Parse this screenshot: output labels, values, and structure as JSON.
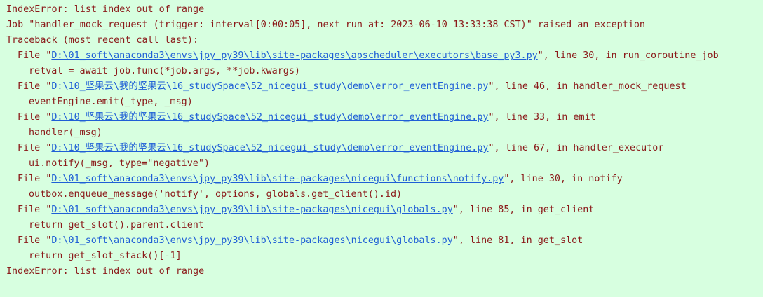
{
  "console": {
    "colors": {
      "background": "#d7ffe0",
      "error_text": "#8b1a1a",
      "link": "#1f5fd6"
    },
    "lines": [
      {
        "text": "IndexError: list index out of range"
      },
      {
        "text": "Job \"handler_mock_request (trigger: interval[0:00:05], next run at: 2023-06-10 13:33:38 CST)\" raised an exception"
      },
      {
        "text": "Traceback (most recent call last):"
      },
      {
        "file_prefix": "File \"",
        "path": "D:\\01_soft\\anaconda3\\envs\\jpy_py39\\lib\\site-packages\\apscheduler\\executors\\base_py3.py",
        "rest": "\", line 30, in run_coroutine_job"
      },
      {
        "code": "retval = await job.func(*job.args, **job.kwargs)"
      },
      {
        "file_prefix": "File \"",
        "path": "D:\\10_坚果云\\我的坚果云\\16_studySpace\\52_nicegui_study\\demo\\error_eventEngine.py",
        "rest": "\", line 46, in handler_mock_request"
      },
      {
        "code": "eventEngine.emit(_type, _msg)"
      },
      {
        "file_prefix": "File \"",
        "path": "D:\\10_坚果云\\我的坚果云\\16_studySpace\\52_nicegui_study\\demo\\error_eventEngine.py",
        "rest": "\", line 33, in emit"
      },
      {
        "code": "handler(_msg)"
      },
      {
        "file_prefix": "File \"",
        "path": "D:\\10_坚果云\\我的坚果云\\16_studySpace\\52_nicegui_study\\demo\\error_eventEngine.py",
        "rest": "\", line 67, in handler_executor"
      },
      {
        "code": "ui.notify(_msg, type=\"negative\")"
      },
      {
        "file_prefix": "File \"",
        "path": "D:\\01_soft\\anaconda3\\envs\\jpy_py39\\lib\\site-packages\\nicegui\\functions\\notify.py",
        "rest": "\", line 30, in notify"
      },
      {
        "code": "outbox.enqueue_message('notify', options, globals.get_client().id)"
      },
      {
        "file_prefix": "File \"",
        "path": "D:\\01_soft\\anaconda3\\envs\\jpy_py39\\lib\\site-packages\\nicegui\\globals.py",
        "rest": "\", line 85, in get_client"
      },
      {
        "code": "return get_slot().parent.client"
      },
      {
        "file_prefix": "File \"",
        "path": "D:\\01_soft\\anaconda3\\envs\\jpy_py39\\lib\\site-packages\\nicegui\\globals.py",
        "rest": "\", line 81, in get_slot"
      },
      {
        "code": "return get_slot_stack()[-1]"
      },
      {
        "text": "IndexError: list index out of range"
      }
    ]
  }
}
